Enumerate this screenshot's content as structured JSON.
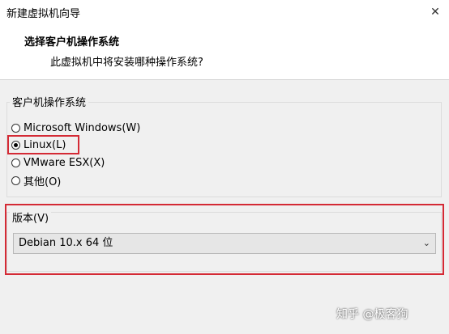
{
  "window": {
    "title": "新建虚拟机向导",
    "close_glyph": "✕"
  },
  "header": {
    "title": "选择客户机操作系统",
    "subtitle": "此虚拟机中将安装哪种操作系统?"
  },
  "guest_os": {
    "label": "客户机操作系统",
    "options": [
      {
        "label": "Microsoft Windows(W)",
        "checked": false
      },
      {
        "label": "Linux(L)",
        "checked": true
      },
      {
        "label": "VMware ESX(X)",
        "checked": false
      },
      {
        "label": "其他(O)",
        "checked": false
      }
    ]
  },
  "version": {
    "label": "版本(V)",
    "selected": "Debian 10.x 64 位",
    "chevron": "⌄"
  },
  "watermark": "知乎 @极客狗",
  "colors": {
    "highlight": "#d42a35",
    "background": "#f0f0f0"
  }
}
